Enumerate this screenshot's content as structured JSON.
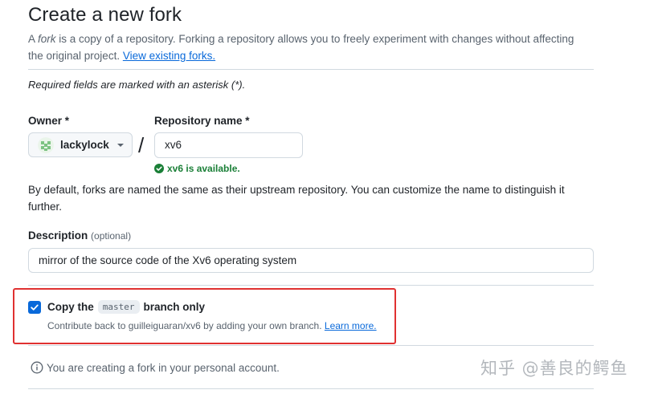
{
  "header": {
    "title": "Create a new fork",
    "intro_prefix": "A ",
    "intro_em": "fork",
    "intro_text": " is a copy of a repository. Forking a repository allows you to freely experiment with changes without affecting the original project. ",
    "intro_link": "View existing forks."
  },
  "form": {
    "required_note": "Required fields are marked with an asterisk (*).",
    "owner": {
      "label": "Owner *",
      "value": "lackylock",
      "avatar_icon": "identicon-avatar"
    },
    "separator": "/",
    "repository": {
      "label": "Repository name *",
      "value": "xv6",
      "availability": "xv6 is available.",
      "status_color": "#1a7f37"
    },
    "default_note": "By default, forks are named the same as their upstream repository. You can customize the name to distinguish it further.",
    "description": {
      "label": "Description",
      "optional": "(optional)",
      "value": "mirror of the source code of the Xv6 operating system"
    },
    "copy_branch": {
      "checked": true,
      "label_prefix": "Copy the",
      "branch": "master",
      "label_suffix": "branch only",
      "sub_text": "Contribute back to guilleiguaran/xv6 by adding your own branch. ",
      "sub_link": "Learn more."
    },
    "info": {
      "icon": "info-icon",
      "text": "You are creating a fork in your personal account."
    }
  },
  "overlay": {
    "highlight_color": "#e03131",
    "watermark": "知乎 @善良的鳄鱼"
  },
  "colors": {
    "accent": "#0969da",
    "success": "#1a7f37",
    "muted": "#59636e"
  }
}
